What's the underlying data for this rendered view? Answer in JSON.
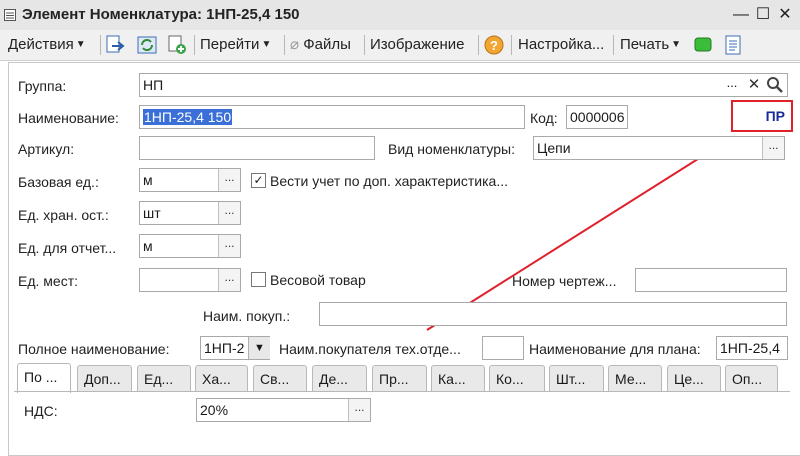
{
  "window": {
    "title": "Элемент Номенклатура: 1НП-25,4 150",
    "minimize_icon": "minimize-icon",
    "maximize_icon": "maximize-icon",
    "close_icon": "close-icon"
  },
  "toolbar": {
    "actions": "Действия",
    "goto": "Перейти",
    "files": "Файлы",
    "image": "Изображение",
    "settings": "Настройка...",
    "print": "Печать"
  },
  "form": {
    "group_label": "Группа:",
    "group_value": "НП",
    "name_label": "Наименование:",
    "name_value": "1НП-25,4 150",
    "code_label": "Код:",
    "code_value": "0000006",
    "annotation_badge": "ПР",
    "article_label": "Артикул:",
    "article_value": "",
    "type_label": "Вид номенклатуры:",
    "type_value": "Цепи",
    "base_unit_label": "Базовая ед.:",
    "base_unit_value": "м",
    "track_chars_label": "Вести учет по доп.  характеристика...",
    "track_chars_checked": true,
    "storage_unit_label": "Ед. хран. ост.:",
    "storage_unit_value": "шт",
    "report_unit_label": "Ед. для отчет...",
    "report_unit_value": "м",
    "places_unit_label": "Ед. мест:",
    "places_unit_value": "",
    "weight_label": "Весовой товар",
    "weight_checked": false,
    "drawing_label": "Номер чертеж...",
    "drawing_value": "",
    "buyer_name_label": "Наим. покуп.:",
    "buyer_name_value": "",
    "full_name_label": "Полное наименование:",
    "full_name_value": "1НП-2",
    "buyer_tech_label": "Наим.покупателя тех.отде...",
    "buyer_tech_value": "",
    "plan_name_label": "Наименование для плана:",
    "plan_name_value": "1НП-25,4",
    "vat_label": "НДС:",
    "vat_value": "20%"
  },
  "tabs": [
    "По ...",
    "Доп...",
    "Ед...",
    "Ха...",
    "Св...",
    "Де...",
    "Пр...",
    "Ка...",
    "Ко...",
    "Шт...",
    "Ме...",
    "Це...",
    "Оп..."
  ],
  "colors": {
    "annotation": "#e0202a",
    "badge_text": "#1a2a9a",
    "selection": "#3a6fd8"
  }
}
